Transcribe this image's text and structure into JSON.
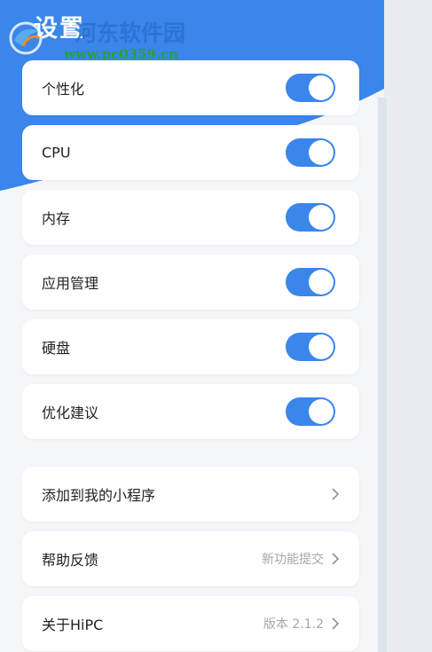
{
  "header": {
    "title": "设置"
  },
  "watermark": {
    "name": "河东软件园",
    "url": "www.pc0359.cn"
  },
  "toggles": [
    {
      "label": "个性化",
      "on": true
    },
    {
      "label": "CPU",
      "on": true
    },
    {
      "label": "内存",
      "on": true
    },
    {
      "label": "应用管理",
      "on": true
    },
    {
      "label": "硬盘",
      "on": true
    },
    {
      "label": "优化建议",
      "on": true
    }
  ],
  "links": [
    {
      "label": "添加到我的小程序",
      "value": ""
    },
    {
      "label": "帮助反馈",
      "value": "新功能提交"
    },
    {
      "label": "关于HiPC",
      "value": "版本 2.1.2"
    }
  ],
  "colors": {
    "accent": "#3a86ea",
    "background": "#f4f6f9"
  }
}
